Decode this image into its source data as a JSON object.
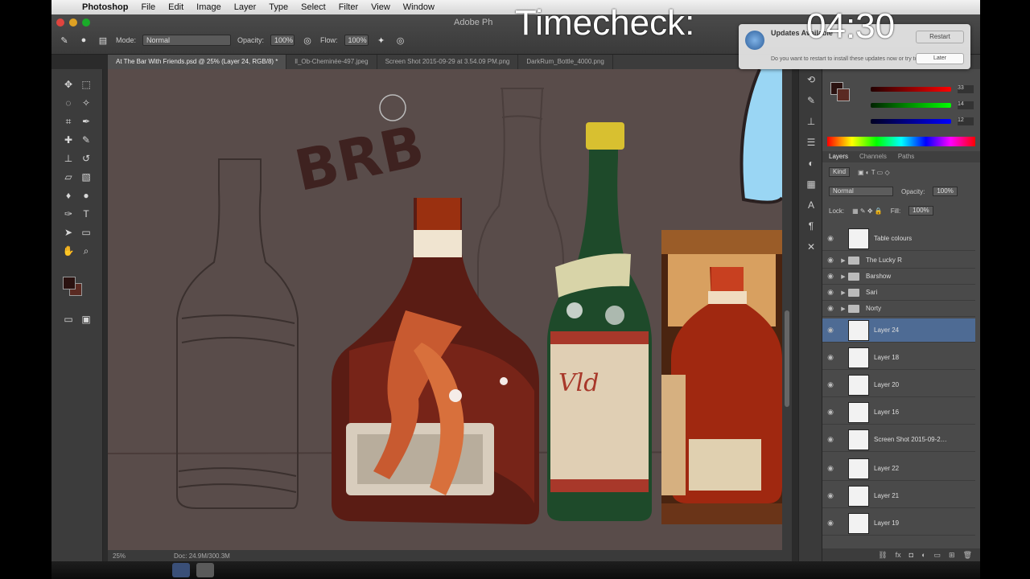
{
  "menubar": {
    "app": "Photoshop",
    "items": [
      "File",
      "Edit",
      "Image",
      "Layer",
      "Type",
      "Select",
      "Filter",
      "View",
      "Window"
    ]
  },
  "optbar": {
    "doc_title": "Adobe Ph",
    "mode_label": "Mode:",
    "mode_value": "Normal",
    "opacity_label": "Opacity:",
    "opacity_value": "100%",
    "flow_label": "Flow:",
    "flow_value": "100%"
  },
  "tabs": [
    "At The Bar With Friends.psd @ 25% (Layer 24, RGB/8) *",
    "ll_Ob-Cheminée-497.jpeg",
    "Screen Shot 2015-09-29 at 3.54.09 PM.png",
    "DarkRum_Bottle_4000.png"
  ],
  "canvas": {
    "sketch_text": "BRB"
  },
  "statusbar": {
    "zoom": "25%",
    "doc": "Doc: 24.9M/300.3M"
  },
  "overlay": {
    "label": "Timecheck:",
    "time": "04:30"
  },
  "notification": {
    "title": "Updates Available",
    "body": "Do you want to restart to install these updates now or try tonight?",
    "button_primary": "Restart",
    "button_secondary": "Later"
  },
  "colors": {
    "r": "33",
    "g": "14",
    "b": "12"
  },
  "panel_tabs": [
    "Layers",
    "Channels",
    "Paths"
  ],
  "layer_ctrl": {
    "kind": "Kind",
    "blend": "Normal",
    "opacity_label": "Opacity:",
    "opacity_value": "100%",
    "lock_label": "Lock:",
    "fill_label": "Fill:",
    "fill_value": "100%"
  },
  "layers": [
    {
      "name": "Table colours",
      "type": "layer"
    },
    {
      "name": "The Lucky R",
      "type": "group"
    },
    {
      "name": "Barshow",
      "type": "group"
    },
    {
      "name": "Sari",
      "type": "group"
    },
    {
      "name": "Norty",
      "type": "group"
    },
    {
      "name": "Layer 24",
      "type": "layer",
      "selected": true
    },
    {
      "name": "Layer 18",
      "type": "layer"
    },
    {
      "name": "Layer 20",
      "type": "layer"
    },
    {
      "name": "Layer 16",
      "type": "layer"
    },
    {
      "name": "Screen Shot 2015-09-2…",
      "type": "layer"
    },
    {
      "name": "Layer 22",
      "type": "layer"
    },
    {
      "name": "Layer 21",
      "type": "layer"
    },
    {
      "name": "Layer 19",
      "type": "layer"
    }
  ]
}
